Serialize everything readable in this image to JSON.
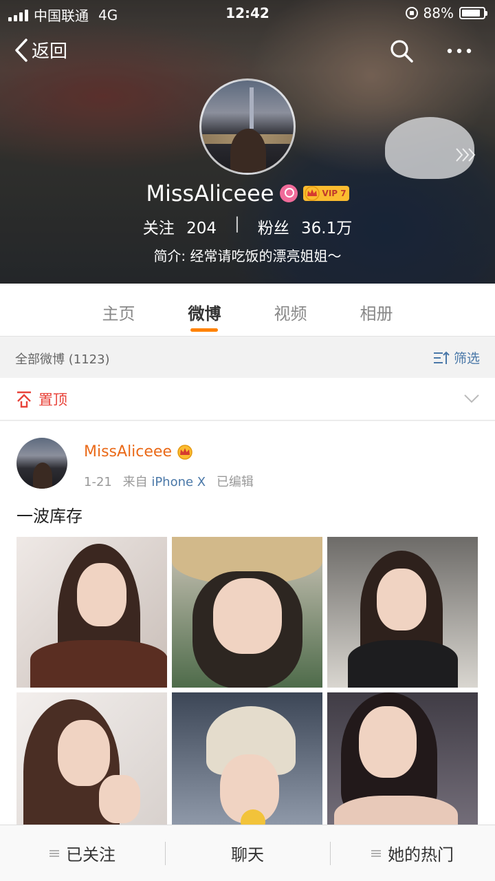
{
  "status_bar": {
    "carrier": "中国联通",
    "network": "4G",
    "time": "12:42",
    "battery": "88%",
    "battery_level": 0.88
  },
  "nav": {
    "back_label": "返回",
    "icons": [
      "chevron-left-icon",
      "search-icon",
      "more-icon"
    ]
  },
  "profile": {
    "name": "MissAliceee",
    "vip_level": "VIP 7",
    "following_label": "关注",
    "following_count": "204",
    "divider": "|",
    "fans_label": "粉丝",
    "fans_count": "36.1万",
    "bio": "简介: 经常请吃饭的漂亮姐姐～"
  },
  "tabs": [
    {
      "label": "主页",
      "active": false
    },
    {
      "label": "微博",
      "active": true
    },
    {
      "label": "视频",
      "active": false
    },
    {
      "label": "相册",
      "active": false
    }
  ],
  "feed_header": {
    "count_label": "全部微博 (1123)",
    "filter_label": "筛选"
  },
  "pinned": {
    "label": "置顶"
  },
  "post": {
    "author": "MissAliceee",
    "date": "1-21",
    "source_prefix": "来自",
    "source": "iPhone X",
    "edited": "已编辑",
    "text": "一波库存",
    "photo_count": 6
  },
  "bottom_bar": {
    "followed_label": "已关注",
    "chat_label": "聊天",
    "hot_label": "她的热门"
  },
  "colors": {
    "accent_orange": "#ff8200",
    "author_orange": "#ea6a19",
    "link_blue": "#4a78a8",
    "pin_red": "#e8433a"
  }
}
